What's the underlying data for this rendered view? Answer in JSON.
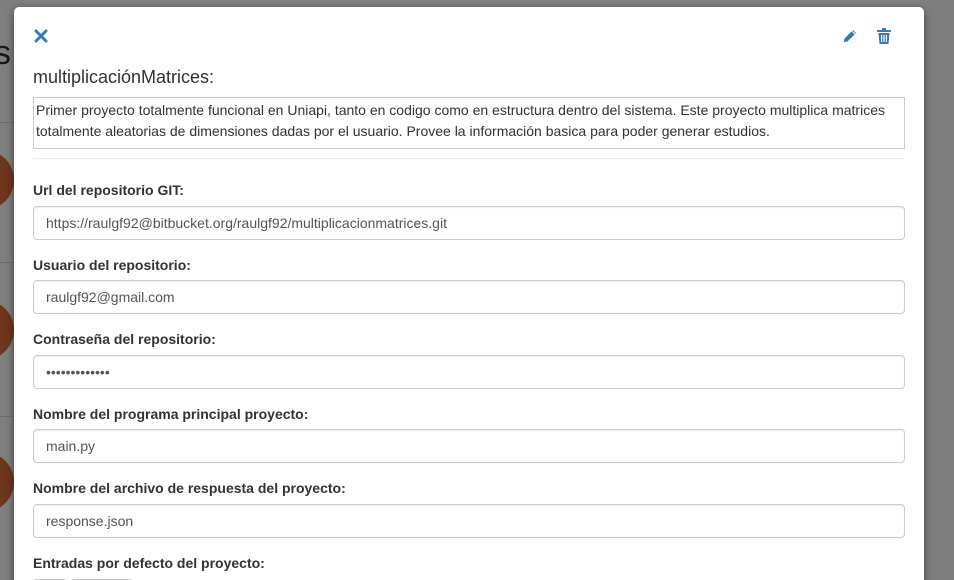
{
  "background": {
    "heading_fragment": "s"
  },
  "modal": {
    "title": "multiplicaciónMatrices:",
    "description": "Primer proyecto totalmente funcional en Uniapi, tanto en codigo como en estructura dentro del sistema. Este proyecto multiplica matrices totalmente aleatorias de dimensiones dadas por el usuario. Provee la información basica para poder generar estudios.",
    "icons": {
      "close": "close-icon",
      "edit": "pencil-icon",
      "delete": "trash-icon"
    },
    "accent_color": "#337ab7",
    "fields": {
      "repo_url": {
        "label": "Url del repositorio GIT:",
        "value": "https://raulgf92@bitbucket.org/raulgf92/multiplicacionmatrices.git"
      },
      "repo_user": {
        "label": "Usuario del repositorio:",
        "value": "raulgf92@gmail.com"
      },
      "repo_password": {
        "label": "Contraseña del repositorio:",
        "value": "•••••••••••••"
      },
      "main_program": {
        "label": "Nombre del programa principal proyecto:",
        "value": "main.py"
      },
      "response_file": {
        "label": "Nombre del archivo de respuesta del proyecto:",
        "value": "response.json"
      },
      "default_inputs": {
        "label": "Entradas por defecto del proyecto:"
      }
    }
  }
}
